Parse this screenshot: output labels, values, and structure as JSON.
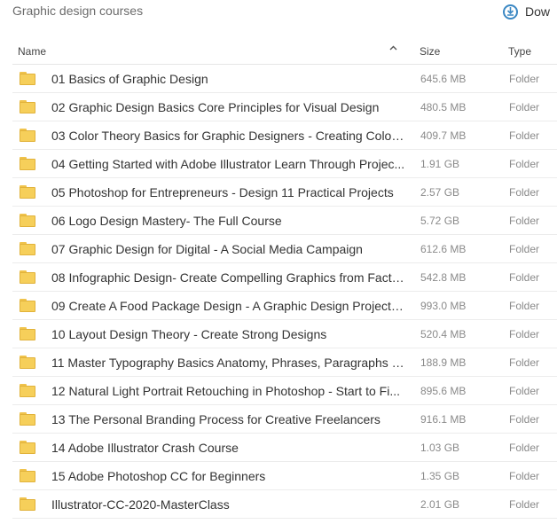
{
  "breadcrumb": "Graphic design courses",
  "download_label": "Dow",
  "columns": {
    "name": "Name",
    "size": "Size",
    "type": "Type",
    "sort_glyph": "^"
  },
  "rows": [
    {
      "name": "01 Basics of Graphic Design",
      "size": "645.6 MB",
      "type": "Folder"
    },
    {
      "name": "02 Graphic Design Basics Core Principles for Visual Design",
      "size": "480.5 MB",
      "type": "Folder"
    },
    {
      "name": "03 Color Theory Basics for Graphic Designers - Creating Color ...",
      "size": "409.7 MB",
      "type": "Folder"
    },
    {
      "name": "04 Getting Started with Adobe Illustrator Learn Through Projec...",
      "size": "1.91 GB",
      "type": "Folder"
    },
    {
      "name": "05 Photoshop for Entrepreneurs - Design 11 Practical Projects",
      "size": "2.57 GB",
      "type": "Folder"
    },
    {
      "name": "06 Logo Design Mastery- The Full Course",
      "size": "5.72 GB",
      "type": "Folder"
    },
    {
      "name": "07 Graphic Design for Digital - A Social Media Campaign",
      "size": "612.6 MB",
      "type": "Folder"
    },
    {
      "name": "08 Infographic Design- Create Compelling Graphics from Facts ...",
      "size": "542.8 MB",
      "type": "Folder"
    },
    {
      "name": "09 Create A Food Package Design - A Graphic Design Project f...",
      "size": "993.0 MB",
      "type": "Folder"
    },
    {
      "name": "10 Layout Design Theory - Create Strong Designs",
      "size": "520.4 MB",
      "type": "Folder"
    },
    {
      "name": "11 Master Typography Basics Anatomy, Phrases, Paragraphs an...",
      "size": "188.9 MB",
      "type": "Folder"
    },
    {
      "name": "12 Natural Light Portrait Retouching in Photoshop - Start to Fi...",
      "size": "895.6 MB",
      "type": "Folder"
    },
    {
      "name": "13 The Personal Branding Process for Creative Freelancers",
      "size": "916.1 MB",
      "type": "Folder"
    },
    {
      "name": "14 Adobe Illustrator Crash Course",
      "size": "1.03 GB",
      "type": "Folder"
    },
    {
      "name": "15 Adobe Photoshop CC for Beginners",
      "size": "1.35 GB",
      "type": "Folder"
    },
    {
      "name": "Illustrator-CC-2020-MasterClass",
      "size": "2.01 GB",
      "type": "Folder"
    }
  ]
}
